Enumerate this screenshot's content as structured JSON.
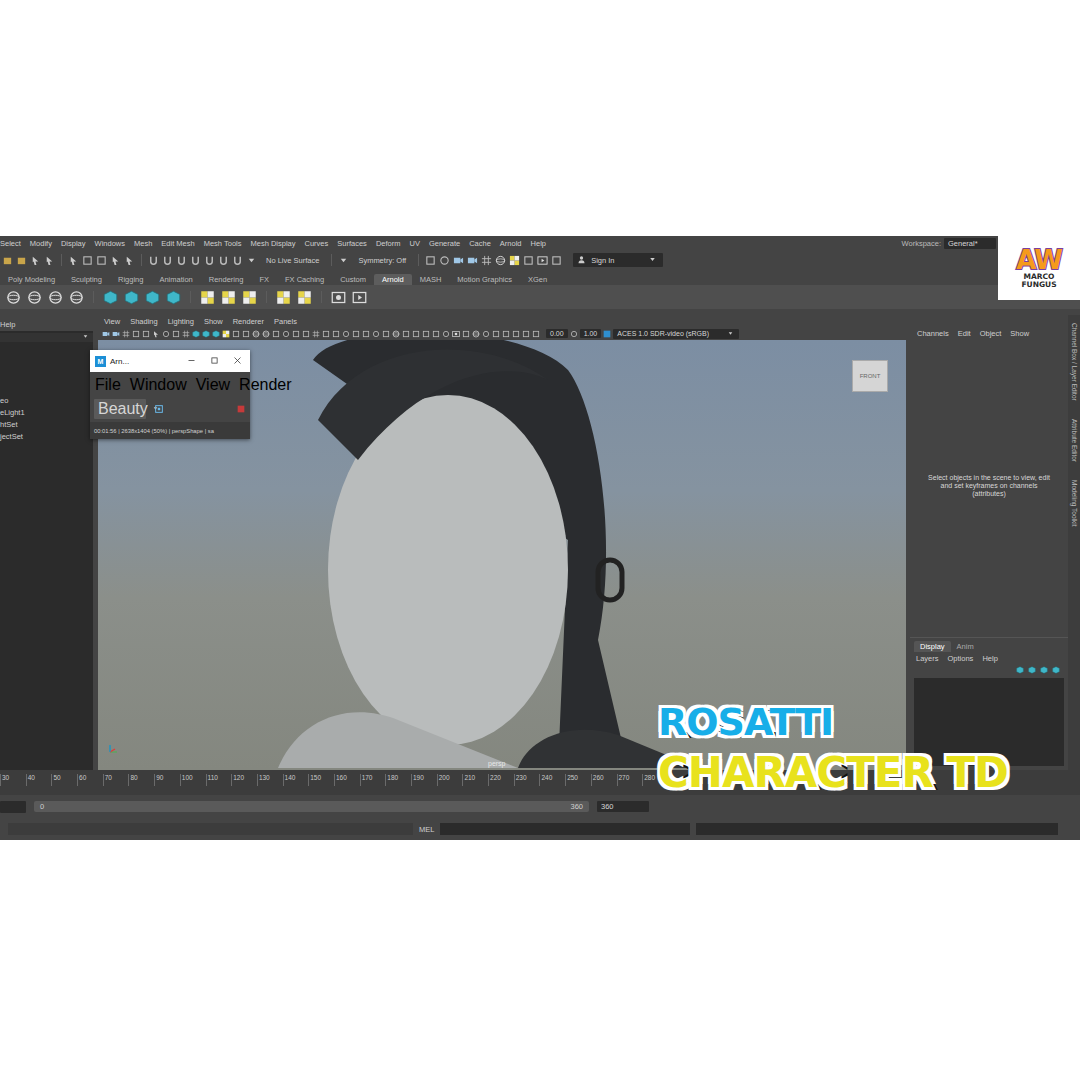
{
  "menubar": {
    "items": [
      "Select",
      "Modify",
      "Display",
      "Windows",
      "Mesh",
      "Edit Mesh",
      "Mesh Tools",
      "Mesh Display",
      "Curves",
      "Surfaces",
      "Deform",
      "UV",
      "Generate",
      "Cache",
      "Arnold",
      "Help"
    ],
    "workspace_label": "Workspace:",
    "workspace_value": "General*"
  },
  "status_line": {
    "live_surface": "No Live Surface",
    "symmetry": "Symmetry: Off",
    "sign_in": "Sign In"
  },
  "shelf": {
    "tabs": [
      {
        "label": "Poly Modeling",
        "selected": false
      },
      {
        "label": "Sculpting",
        "selected": false
      },
      {
        "label": "Rigging",
        "selected": false
      },
      {
        "label": "Animation",
        "selected": false
      },
      {
        "label": "Rendering",
        "selected": false
      },
      {
        "label": "FX",
        "selected": false
      },
      {
        "label": "FX Caching",
        "selected": false
      },
      {
        "label": "Custom",
        "selected": false
      },
      {
        "label": "Arnold",
        "selected": true
      },
      {
        "label": "MASH",
        "selected": false
      },
      {
        "label": "Motion Graphics",
        "selected": false
      },
      {
        "label": "XGen",
        "selected": false
      }
    ]
  },
  "outliner": {
    "header": "Help",
    "items": [
      "eo",
      "eLight1",
      "htSet",
      "jectSet"
    ]
  },
  "viewport": {
    "menu": [
      "View",
      "Shading",
      "Lighting",
      "Show",
      "Renderer",
      "Panels"
    ],
    "exposure": "0.00",
    "gamma": "1.00",
    "color_space": "ACES 1.0 SDR-video (sRGB)",
    "view_cube": "FRONT",
    "camera": "persp"
  },
  "arnold_window": {
    "app_icon": "M",
    "title": "Arn...",
    "menu": [
      "File",
      "Window",
      "View",
      "Render"
    ],
    "aov": "Beauty",
    "status": "00:01:56 | 2638x1404 (50%) | perspShape | sa"
  },
  "channel_box": {
    "menu": [
      "Channels",
      "Edit",
      "Object",
      "Show"
    ],
    "message": "Select objects in the scene to view, edit and set keyframes on channels (attributes)",
    "side_tabs": [
      "Channel Box / Layer Editor",
      "Attribute Editor",
      "Modeling Toolkit"
    ]
  },
  "layer_editor": {
    "tabs": [
      {
        "label": "Display",
        "selected": true
      },
      {
        "label": "Anim",
        "selected": false
      }
    ],
    "menu": [
      "Layers",
      "Options",
      "Help"
    ]
  },
  "timeline": {
    "ticks": [
      "30",
      "40",
      "50",
      "60",
      "70",
      "80",
      "90",
      "100",
      "110",
      "120",
      "130",
      "140",
      "150",
      "160",
      "170",
      "180",
      "190",
      "200",
      "210",
      "220",
      "230",
      "240",
      "250",
      "260",
      "270",
      "280"
    ]
  },
  "range_slider": {
    "start": "0",
    "end": "360",
    "end_field": "360"
  },
  "command_line": {
    "language": "MEL"
  },
  "overlay": {
    "logo": {
      "initials": "AW",
      "name_lines": [
        "MARCO",
        "FUNGUS"
      ]
    },
    "title_lines": [
      "ROSATTI",
      "CHARACTER TD"
    ]
  }
}
